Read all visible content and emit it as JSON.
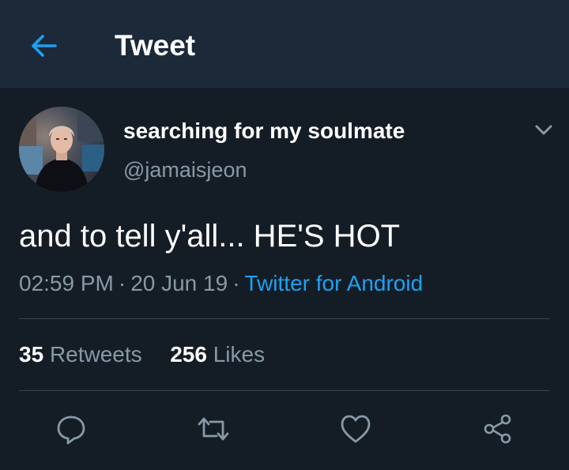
{
  "header": {
    "back_icon": "arrow-left-icon",
    "title": "Tweet"
  },
  "tweet": {
    "author": {
      "display_name": "searching for my soulmate",
      "handle": "@jamaisjeon",
      "avatar": "avatar-photo"
    },
    "menu_icon": "chevron-down-icon",
    "text": "and to tell y'all... HE'S HOT",
    "meta": {
      "time": "02:59 PM",
      "separator": "·",
      "date": "20 Jun 19",
      "source": "Twitter for Android"
    },
    "stats": {
      "retweets_count": "35",
      "retweets_label": "Retweets",
      "likes_count": "256",
      "likes_label": "Likes"
    },
    "actions": [
      "reply-icon",
      "retweet-icon",
      "like-icon",
      "share-icon"
    ]
  },
  "colors": {
    "background": "#141d26",
    "header_background": "#1c2938",
    "accent": "#1da1f2",
    "secondary_text": "#8899a6",
    "divider": "#38444d"
  }
}
